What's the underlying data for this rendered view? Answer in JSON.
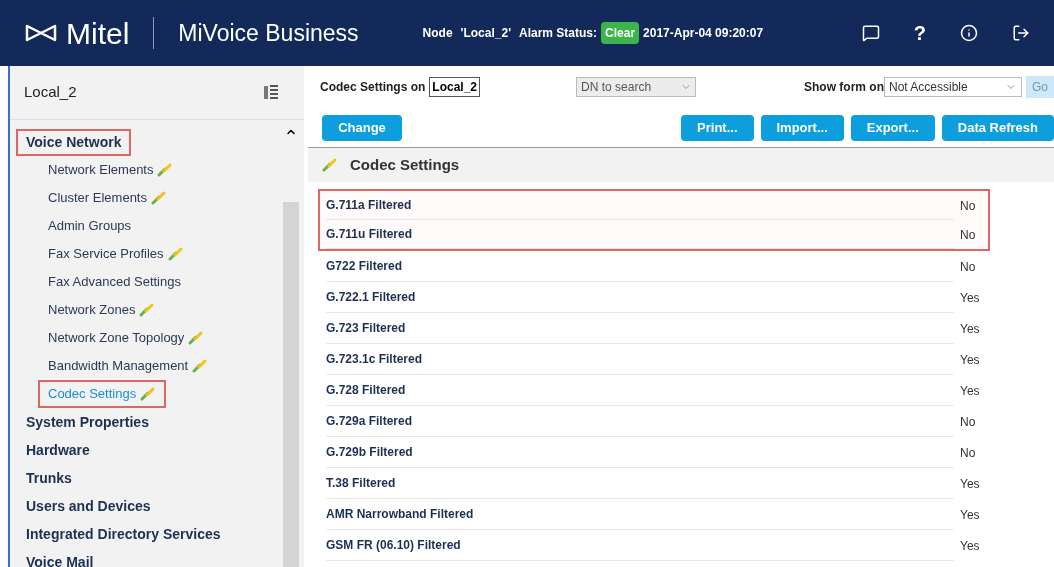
{
  "header": {
    "logo": "Mitel",
    "product": "MiVoice Business",
    "node_label": "Node",
    "node": "'Local_2'",
    "alarm_label": "Alarm Status:",
    "alarm_status": "Clear",
    "datetime": "2017-Apr-04 09:20:07",
    "help": "?"
  },
  "sidebar": {
    "title": "Local_2",
    "items": [
      {
        "label": "Voice Network",
        "highlighted": true,
        "children": [
          {
            "label": "Network Elements",
            "icon": true,
            "selected": false,
            "highlighted": false
          },
          {
            "label": "Cluster Elements",
            "icon": true,
            "selected": false,
            "highlighted": false
          },
          {
            "label": "Admin Groups",
            "icon": false,
            "selected": false,
            "highlighted": false
          },
          {
            "label": "Fax Service Profiles",
            "icon": true,
            "selected": false,
            "highlighted": false
          },
          {
            "label": "Fax Advanced Settings",
            "icon": false,
            "selected": false,
            "highlighted": false
          },
          {
            "label": "Network Zones",
            "icon": true,
            "selected": false,
            "highlighted": false
          },
          {
            "label": "Network Zone Topology",
            "icon": true,
            "selected": false,
            "highlighted": false
          },
          {
            "label": "Bandwidth Management",
            "icon": true,
            "selected": false,
            "highlighted": false
          },
          {
            "label": "Codec Settings",
            "icon": true,
            "selected": true,
            "highlighted": true
          }
        ]
      },
      {
        "label": "System Properties",
        "highlighted": false
      },
      {
        "label": "Hardware",
        "highlighted": false
      },
      {
        "label": "Trunks",
        "highlighted": false
      },
      {
        "label": "Users and Devices",
        "highlighted": false
      },
      {
        "label": "Integrated Directory Services",
        "highlighted": false
      },
      {
        "label": "Voice Mail",
        "highlighted": false
      }
    ]
  },
  "toolbar": {
    "form_label": "Codec Settings on",
    "form_node": "Local_2",
    "search": {
      "placeholder": "DN to search"
    },
    "show_form_label": "Show form on",
    "show_form_value": "Not Accessible",
    "go": "Go",
    "change": "Change",
    "buttons": [
      "Print...",
      "Import...",
      "Export...",
      "Data Refresh"
    ]
  },
  "section_title": "Codec Settings",
  "rows": [
    {
      "label": "G.711a Filtered",
      "value": "No",
      "highlighted": true
    },
    {
      "label": "G.711u Filtered",
      "value": "No",
      "highlighted": true
    },
    {
      "label": "G722 Filtered",
      "value": "No",
      "highlighted": false
    },
    {
      "label": "G.722.1 Filtered",
      "value": "Yes",
      "highlighted": false
    },
    {
      "label": "G.723 Filtered",
      "value": "Yes",
      "highlighted": false
    },
    {
      "label": "G.723.1c Filtered",
      "value": "Yes",
      "highlighted": false
    },
    {
      "label": "G.728 Filtered",
      "value": "Yes",
      "highlighted": false
    },
    {
      "label": "G.729a Filtered",
      "value": "No",
      "highlighted": false
    },
    {
      "label": "G.729b Filtered",
      "value": "No",
      "highlighted": false
    },
    {
      "label": "T.38 Filtered",
      "value": "Yes",
      "highlighted": false
    },
    {
      "label": "AMR Narrowband Filtered",
      "value": "Yes",
      "highlighted": false
    },
    {
      "label": "GSM FR (06.10) Filtered",
      "value": "Yes",
      "highlighted": false
    }
  ]
}
